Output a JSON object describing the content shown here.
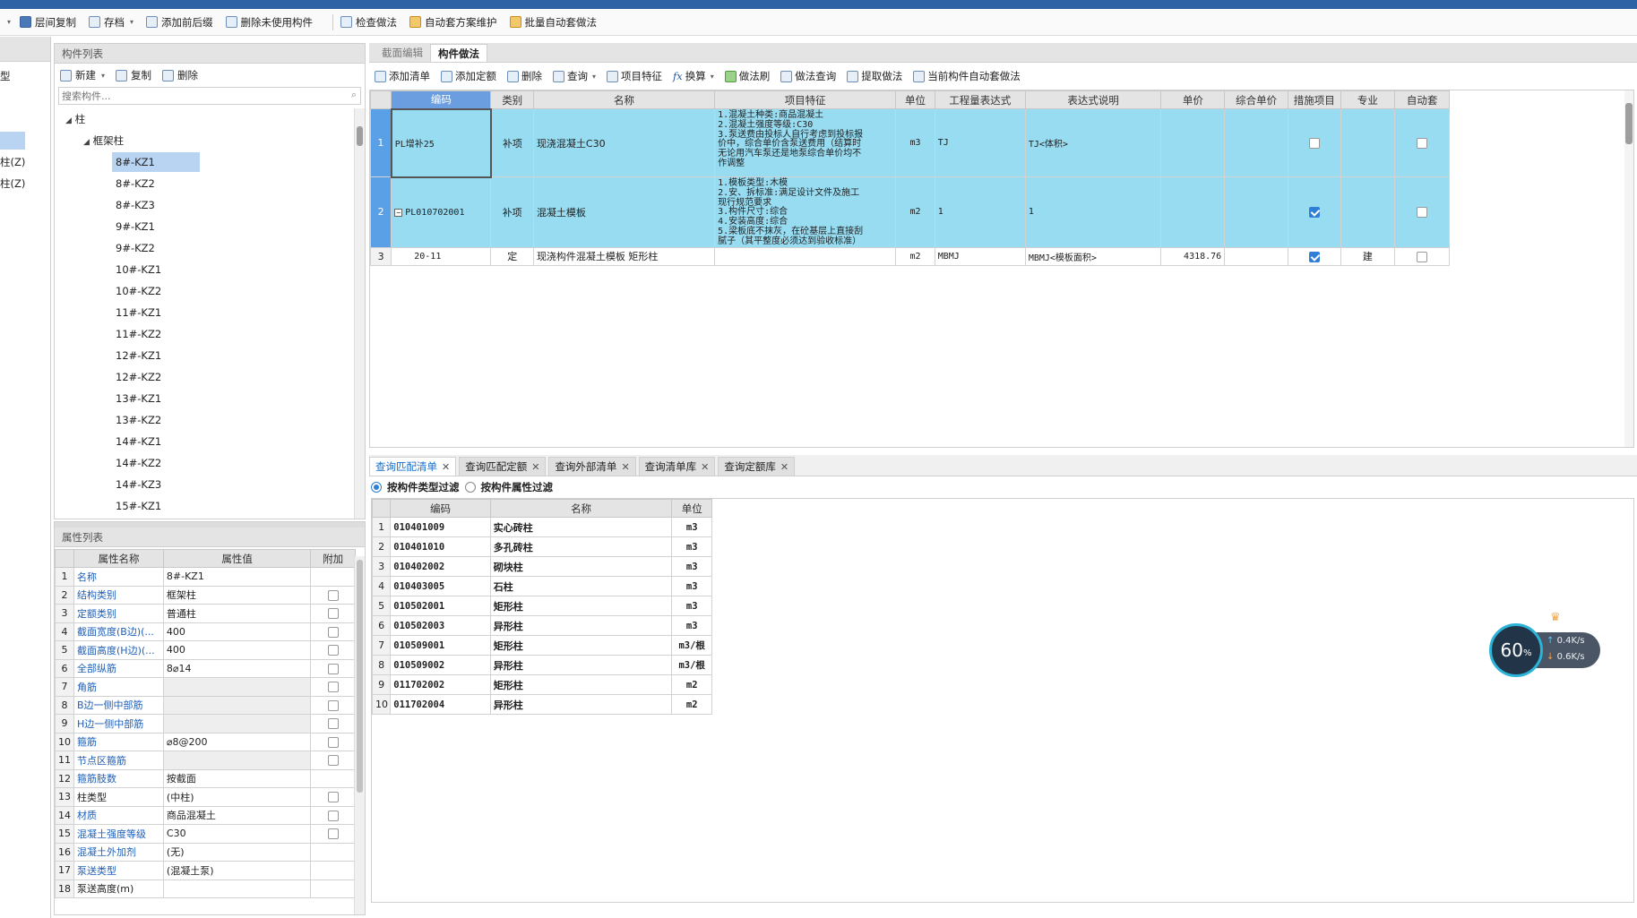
{
  "toolbar": {
    "items": [
      "层间复制",
      "存档",
      "添加前后缀",
      "删除未使用构件",
      "检查做法",
      "自动套方案维护",
      "批量自动套做法"
    ]
  },
  "leftedge": {
    "items": [
      "型",
      "柱(Z)",
      "柱(Z)"
    ]
  },
  "complist": {
    "title": "构件列表",
    "btn_new": "新建",
    "btn_copy": "复制",
    "btn_delete": "删除",
    "search_placeholder": "搜索构件...",
    "root": "柱",
    "group": "框架柱",
    "items": [
      "8#-KZ1",
      "8#-KZ2",
      "8#-KZ3",
      "9#-KZ1",
      "9#-KZ2",
      "10#-KZ1",
      "10#-KZ2",
      "11#-KZ1",
      "11#-KZ2",
      "12#-KZ1",
      "12#-KZ2",
      "13#-KZ1",
      "13#-KZ2",
      "14#-KZ1",
      "14#-KZ2",
      "14#-KZ3",
      "15#-KZ1"
    ]
  },
  "props": {
    "title": "属性列表",
    "headers": [
      "属性名称",
      "属性值",
      "附加"
    ],
    "rows": [
      {
        "n": "1",
        "name": "名称",
        "val": "8#-KZ1",
        "cb": false,
        "link": true,
        "showcb": false
      },
      {
        "n": "2",
        "name": "结构类别",
        "val": "框架柱",
        "cb": false,
        "link": true,
        "showcb": true
      },
      {
        "n": "3",
        "name": "定额类别",
        "val": "普通柱",
        "cb": false,
        "link": true,
        "showcb": true
      },
      {
        "n": "4",
        "name": "截面宽度(B边)(...",
        "val": "400",
        "cb": false,
        "link": true,
        "showcb": true
      },
      {
        "n": "5",
        "name": "截面高度(H边)(...",
        "val": "400",
        "cb": false,
        "link": true,
        "showcb": true
      },
      {
        "n": "6",
        "name": "全部纵筋",
        "val": "8⌀14",
        "cb": false,
        "link": true,
        "showcb": true
      },
      {
        "n": "7",
        "name": "角筋",
        "val": "",
        "cb": false,
        "link": true,
        "showcb": true
      },
      {
        "n": "8",
        "name": "B边一侧中部筋",
        "val": "",
        "cb": false,
        "link": true,
        "showcb": true
      },
      {
        "n": "9",
        "name": "H边一侧中部筋",
        "val": "",
        "cb": false,
        "link": true,
        "showcb": true
      },
      {
        "n": "10",
        "name": "箍筋",
        "val": "⌀8@200",
        "cb": false,
        "link": true,
        "showcb": true
      },
      {
        "n": "11",
        "name": "节点区箍筋",
        "val": "",
        "cb": false,
        "link": true,
        "showcb": true
      },
      {
        "n": "12",
        "name": "箍筋肢数",
        "val": "按截面",
        "cb": false,
        "link": true,
        "showcb": false
      },
      {
        "n": "13",
        "name": "柱类型",
        "val": "(中柱)",
        "cb": false,
        "link": false,
        "showcb": true
      },
      {
        "n": "14",
        "name": "材质",
        "val": "商品混凝土",
        "cb": false,
        "link": true,
        "showcb": true
      },
      {
        "n": "15",
        "name": "混凝土强度等级",
        "val": "C30",
        "cb": false,
        "link": true,
        "showcb": true
      },
      {
        "n": "16",
        "name": "混凝土外加剂",
        "val": "(无)",
        "cb": false,
        "link": true,
        "showcb": false
      },
      {
        "n": "17",
        "name": "泵送类型",
        "val": "(混凝土泵)",
        "cb": false,
        "link": true,
        "showcb": false
      },
      {
        "n": "18",
        "name": "泵送高度(m)",
        "val": "",
        "cb": false,
        "link": false,
        "showcb": false
      }
    ]
  },
  "maintabs": [
    "截面编辑",
    "构件做法"
  ],
  "maintoolbar": [
    "添加清单",
    "添加定额",
    "删除",
    "查询",
    "项目特征",
    "换算",
    "做法刷",
    "做法查询",
    "提取做法",
    "当前构件自动套做法"
  ],
  "grid": {
    "headers": [
      "编码",
      "类别",
      "名称",
      "项目特征",
      "单位",
      "工程量表达式",
      "表达式说明",
      "单价",
      "综合单价",
      "措施项目",
      "专业",
      "自动套"
    ],
    "rows": [
      {
        "n": "1",
        "code": "PL增补25",
        "type": "补项",
        "name": "现浇混凝土C30",
        "feat": [
          "1.混凝土种类:商品混凝土",
          "2.混凝土强度等级:C30",
          "3.泵送费由投标人自行考虑到投标报",
          "价中，综合单价含泵送费用（结算时",
          "无论用汽车泵还是地泵综合单价均不",
          "作调整"
        ],
        "unit": "m3",
        "expr": "TJ",
        "desc": "TJ<体积>",
        "price": "",
        "cprice": "",
        "measure": false,
        "major": "",
        "auto": false
      },
      {
        "n": "2",
        "code": "PL010702001",
        "type": "补项",
        "name": "混凝土模板",
        "feat": [
          "1.模板类型:木模",
          "2.安、拆标准:满足设计文件及施工",
          "现行规范要求",
          "3.构件尺寸:综合",
          "4.安装高度:综合",
          "5.梁板底不抹灰，在砼基层上直接刮",
          "腻子（其平整度必须达到验收标准）"
        ],
        "unit": "m2",
        "expr": "1",
        "desc": "1",
        "price": "",
        "cprice": "",
        "measure": true,
        "major": "",
        "auto": false
      },
      {
        "n": "3",
        "code": "20-11",
        "type": "定",
        "name": "现浇构件混凝土模板 矩形柱",
        "feat": [],
        "unit": "m2",
        "expr": "MBMJ",
        "desc": "MBMJ<模板面积>",
        "price": "4318.76",
        "cprice": "",
        "measure": true,
        "major": "建",
        "auto": false
      }
    ]
  },
  "qtabs": [
    "查询匹配清单",
    "查询匹配定额",
    "查询外部清单",
    "查询清单库",
    "查询定额库"
  ],
  "filter": {
    "opt1": "按构件类型过滤",
    "opt2": "按构件属性过滤"
  },
  "qgrid": {
    "headers": [
      "编码",
      "名称",
      "单位"
    ],
    "rows": [
      {
        "n": "1",
        "code": "010401009",
        "name": "实心砖柱",
        "unit": "m3"
      },
      {
        "n": "2",
        "code": "010401010",
        "name": "多孔砖柱",
        "unit": "m3"
      },
      {
        "n": "3",
        "code": "010402002",
        "name": "砌块柱",
        "unit": "m3"
      },
      {
        "n": "4",
        "code": "010403005",
        "name": "石柱",
        "unit": "m3"
      },
      {
        "n": "5",
        "code": "010502001",
        "name": "矩形柱",
        "unit": "m3"
      },
      {
        "n": "6",
        "code": "010502003",
        "name": "异形柱",
        "unit": "m3"
      },
      {
        "n": "7",
        "code": "010509001",
        "name": "矩形柱",
        "unit": "m3/根"
      },
      {
        "n": "8",
        "code": "010509002",
        "name": "异形柱",
        "unit": "m3/根"
      },
      {
        "n": "9",
        "code": "011702002",
        "name": "矩形柱",
        "unit": "m2"
      },
      {
        "n": "10",
        "code": "011702004",
        "name": "异形柱",
        "unit": "m2"
      }
    ]
  },
  "widget": {
    "pct": "60",
    "pct_sign": "%",
    "up": "0.4K/s",
    "down": "0.6K/s"
  }
}
